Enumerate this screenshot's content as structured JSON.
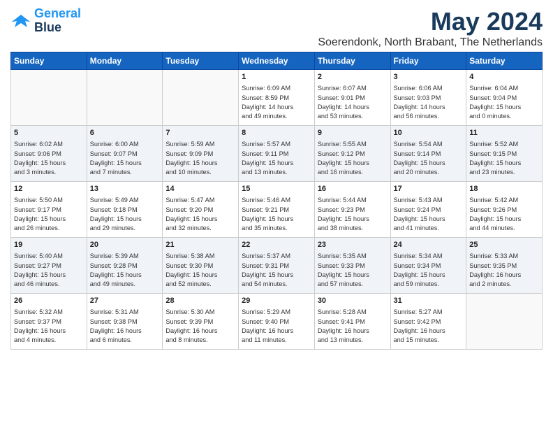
{
  "header": {
    "logo_line1": "General",
    "logo_line2": "Blue",
    "month": "May 2024",
    "location": "Soerendonk, North Brabant, The Netherlands"
  },
  "weekdays": [
    "Sunday",
    "Monday",
    "Tuesday",
    "Wednesday",
    "Thursday",
    "Friday",
    "Saturday"
  ],
  "weeks": [
    [
      {
        "day": "",
        "info": ""
      },
      {
        "day": "",
        "info": ""
      },
      {
        "day": "",
        "info": ""
      },
      {
        "day": "1",
        "info": "Sunrise: 6:09 AM\nSunset: 8:59 PM\nDaylight: 14 hours\nand 49 minutes."
      },
      {
        "day": "2",
        "info": "Sunrise: 6:07 AM\nSunset: 9:01 PM\nDaylight: 14 hours\nand 53 minutes."
      },
      {
        "day": "3",
        "info": "Sunrise: 6:06 AM\nSunset: 9:03 PM\nDaylight: 14 hours\nand 56 minutes."
      },
      {
        "day": "4",
        "info": "Sunrise: 6:04 AM\nSunset: 9:04 PM\nDaylight: 15 hours\nand 0 minutes."
      }
    ],
    [
      {
        "day": "5",
        "info": "Sunrise: 6:02 AM\nSunset: 9:06 PM\nDaylight: 15 hours\nand 3 minutes."
      },
      {
        "day": "6",
        "info": "Sunrise: 6:00 AM\nSunset: 9:07 PM\nDaylight: 15 hours\nand 7 minutes."
      },
      {
        "day": "7",
        "info": "Sunrise: 5:59 AM\nSunset: 9:09 PM\nDaylight: 15 hours\nand 10 minutes."
      },
      {
        "day": "8",
        "info": "Sunrise: 5:57 AM\nSunset: 9:11 PM\nDaylight: 15 hours\nand 13 minutes."
      },
      {
        "day": "9",
        "info": "Sunrise: 5:55 AM\nSunset: 9:12 PM\nDaylight: 15 hours\nand 16 minutes."
      },
      {
        "day": "10",
        "info": "Sunrise: 5:54 AM\nSunset: 9:14 PM\nDaylight: 15 hours\nand 20 minutes."
      },
      {
        "day": "11",
        "info": "Sunrise: 5:52 AM\nSunset: 9:15 PM\nDaylight: 15 hours\nand 23 minutes."
      }
    ],
    [
      {
        "day": "12",
        "info": "Sunrise: 5:50 AM\nSunset: 9:17 PM\nDaylight: 15 hours\nand 26 minutes."
      },
      {
        "day": "13",
        "info": "Sunrise: 5:49 AM\nSunset: 9:18 PM\nDaylight: 15 hours\nand 29 minutes."
      },
      {
        "day": "14",
        "info": "Sunrise: 5:47 AM\nSunset: 9:20 PM\nDaylight: 15 hours\nand 32 minutes."
      },
      {
        "day": "15",
        "info": "Sunrise: 5:46 AM\nSunset: 9:21 PM\nDaylight: 15 hours\nand 35 minutes."
      },
      {
        "day": "16",
        "info": "Sunrise: 5:44 AM\nSunset: 9:23 PM\nDaylight: 15 hours\nand 38 minutes."
      },
      {
        "day": "17",
        "info": "Sunrise: 5:43 AM\nSunset: 9:24 PM\nDaylight: 15 hours\nand 41 minutes."
      },
      {
        "day": "18",
        "info": "Sunrise: 5:42 AM\nSunset: 9:26 PM\nDaylight: 15 hours\nand 44 minutes."
      }
    ],
    [
      {
        "day": "19",
        "info": "Sunrise: 5:40 AM\nSunset: 9:27 PM\nDaylight: 15 hours\nand 46 minutes."
      },
      {
        "day": "20",
        "info": "Sunrise: 5:39 AM\nSunset: 9:28 PM\nDaylight: 15 hours\nand 49 minutes."
      },
      {
        "day": "21",
        "info": "Sunrise: 5:38 AM\nSunset: 9:30 PM\nDaylight: 15 hours\nand 52 minutes."
      },
      {
        "day": "22",
        "info": "Sunrise: 5:37 AM\nSunset: 9:31 PM\nDaylight: 15 hours\nand 54 minutes."
      },
      {
        "day": "23",
        "info": "Sunrise: 5:35 AM\nSunset: 9:33 PM\nDaylight: 15 hours\nand 57 minutes."
      },
      {
        "day": "24",
        "info": "Sunrise: 5:34 AM\nSunset: 9:34 PM\nDaylight: 15 hours\nand 59 minutes."
      },
      {
        "day": "25",
        "info": "Sunrise: 5:33 AM\nSunset: 9:35 PM\nDaylight: 16 hours\nand 2 minutes."
      }
    ],
    [
      {
        "day": "26",
        "info": "Sunrise: 5:32 AM\nSunset: 9:37 PM\nDaylight: 16 hours\nand 4 minutes."
      },
      {
        "day": "27",
        "info": "Sunrise: 5:31 AM\nSunset: 9:38 PM\nDaylight: 16 hours\nand 6 minutes."
      },
      {
        "day": "28",
        "info": "Sunrise: 5:30 AM\nSunset: 9:39 PM\nDaylight: 16 hours\nand 8 minutes."
      },
      {
        "day": "29",
        "info": "Sunrise: 5:29 AM\nSunset: 9:40 PM\nDaylight: 16 hours\nand 11 minutes."
      },
      {
        "day": "30",
        "info": "Sunrise: 5:28 AM\nSunset: 9:41 PM\nDaylight: 16 hours\nand 13 minutes."
      },
      {
        "day": "31",
        "info": "Sunrise: 5:27 AM\nSunset: 9:42 PM\nDaylight: 16 hours\nand 15 minutes."
      },
      {
        "day": "",
        "info": ""
      }
    ]
  ]
}
